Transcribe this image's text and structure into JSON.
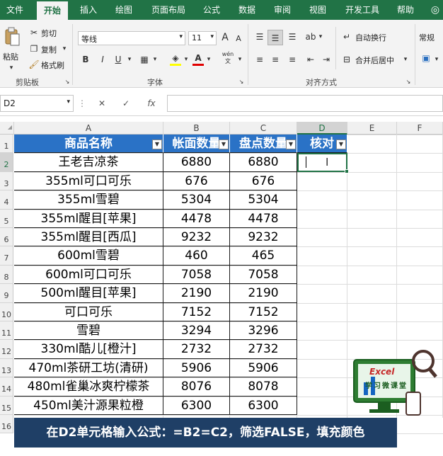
{
  "ribbon_tabs": [
    "文件",
    "开始",
    "插入",
    "绘图",
    "页面布局",
    "公式",
    "数据",
    "审阅",
    "视图",
    "开发工具",
    "帮助"
  ],
  "clipboard": {
    "paste": "粘贴",
    "cut": "剪切",
    "copy": "复制",
    "format_painter": "格式刷",
    "group": "剪贴板"
  },
  "font": {
    "name": "等线",
    "size": "11",
    "grow": "A",
    "shrink": "A",
    "bold": "B",
    "italic": "I",
    "underline": "U",
    "phonetic": "wén",
    "group": "字体"
  },
  "alignment": {
    "wrap_text": "自动换行",
    "merge_center": "合并后居中",
    "group": "对齐方式"
  },
  "number": {
    "format": "常规"
  },
  "formula_bar": {
    "name_box": "D2",
    "fx": "fx",
    "value": ""
  },
  "columns": [
    "A",
    "B",
    "C",
    "D",
    "E",
    "F"
  ],
  "rows": [
    "1",
    "2",
    "3",
    "4",
    "5",
    "6",
    "7",
    "8",
    "9",
    "10",
    "11",
    "12",
    "13",
    "14",
    "15",
    "16"
  ],
  "table": {
    "headers": [
      "商品名称",
      "帐面数量",
      "盘点数量",
      "核对"
    ],
    "data": [
      [
        "王老吉凉茶",
        "6880",
        "6880"
      ],
      [
        "355ml可口可乐",
        "676",
        "676"
      ],
      [
        "355ml雪碧",
        "5304",
        "5304"
      ],
      [
        "355ml醒目[苹果]",
        "4478",
        "4478"
      ],
      [
        "355ml醒目[西瓜]",
        "9232",
        "9232"
      ],
      [
        "600ml雪碧",
        "460",
        "465"
      ],
      [
        "600ml可口可乐",
        "7058",
        "7058"
      ],
      [
        "500ml醒目[苹果]",
        "2190",
        "2190"
      ],
      [
        "可口可乐",
        "7152",
        "7152"
      ],
      [
        "雪碧",
        "3294",
        "3296"
      ],
      [
        "330ml酷儿[橙汁]",
        "2732",
        "2732"
      ],
      [
        "470ml茶研工坊(清研)",
        "5906",
        "5906"
      ],
      [
        "480ml雀巢冰爽柠檬茶",
        "8076",
        "8078"
      ],
      [
        "450ml美汁源果粒橙",
        "6300",
        "6300"
      ]
    ]
  },
  "logo": {
    "text": "Excel",
    "sub": "学习微课堂"
  },
  "caption": "在D2单元格输入公式：=B2=C2，筛选FALSE，填充颜色",
  "colors": {
    "excel_green": "#217346",
    "header_blue": "#2a72c6",
    "caption_bg": "#1f3f66"
  }
}
